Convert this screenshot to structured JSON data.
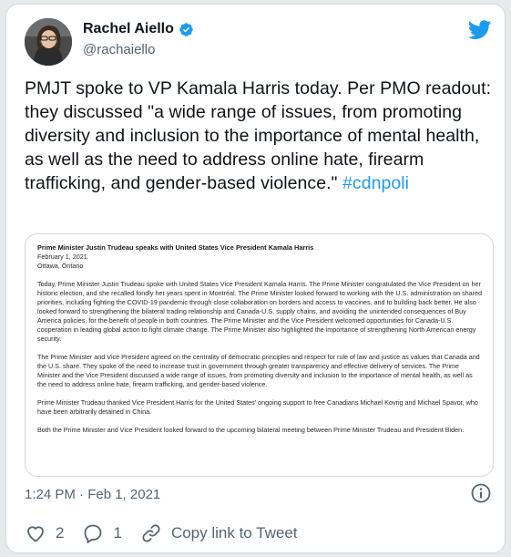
{
  "author": {
    "display_name": "Rachel Aiello",
    "handle": "@rachaiello",
    "avatar_icon": "user-avatar",
    "verified_icon": "verified-badge-icon"
  },
  "tweet": {
    "text": "PMJT spoke to VP Kamala Harris today. Per PMO readout: they discussed \"a wide range of issues, from promoting diversity and inclusion to the importance of mental health, as well as the need to address online hate, firearm trafficking, and gender-based violence.\" ",
    "hashtag": "#cdnpoli",
    "timestamp": "1:24 PM · Feb 1, 2021"
  },
  "attachment": {
    "title": "Prime Minister Justin Trudeau speaks with United States Vice President Kamala Harris",
    "date": "February 1, 2021",
    "location": "Ottawa, Ontario",
    "paragraphs": [
      "Today, Prime Minister Justin Trudeau spoke with United States Vice President Kamala Harris. The Prime Minister congratulated the Vice President on her historic election, and she recalled fondly her years spent in Montréal. The Prime Minister looked forward to working with the U.S. administration on shared priorities, including fighting the COVID-19 pandemic through close collaboration on borders and access to vaccines, and to building back better. He also looked forward to strengthening the bilateral trading relationship and Canada-U.S. supply chains, and avoiding the unintended consequences of Buy America policies, for the benefit of people in both countries. The Prime Minister and the Vice President welcomed opportunities for Canada-U.S. cooperation in leading global action to fight climate change. The Prime Minister also highlighted the importance of strengthening North American energy security.",
      "The Prime Minister and Vice President agreed on the centrality of democratic principles and respect for rule of law and justice as values that Canada and the U.S. share. They spoke of the need to increase trust in government through greater transparency and effective delivery of services. The Prime Minister and the Vice President discussed a wide range of issues, from promoting diversity and inclusion to the importance of mental health, as well as the need to address online hate, firearm trafficking, and gender-based violence.",
      "Prime Minister Trudeau thanked Vice President Harris for the United States' ongoing support to free Canadians Michael Kovrig and Michael Spavor, who have been arbitrarily detained in China.",
      "Both the Prime Minister and Vice President looked forward to the upcoming bilateral meeting between Prime Minister Trudeau and President Biden."
    ]
  },
  "actions": {
    "like_count": "2",
    "reply_count": "1",
    "copy_link_label": "Copy link to Tweet"
  },
  "colors": {
    "accent": "#1d9bf0",
    "text": "#0f1419",
    "secondary": "#536471",
    "border": "#cfd9de"
  }
}
